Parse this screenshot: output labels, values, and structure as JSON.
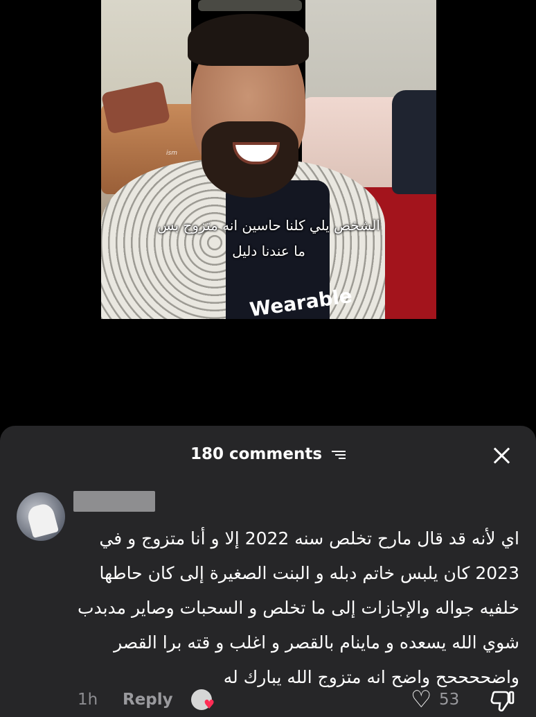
{
  "video": {
    "caption_line1": "الشخص يلي كلنا حاسين انه متزوج بس",
    "caption_line2": "ما عندنا دليل",
    "watermark": "ism",
    "shirt_text": "Wearable"
  },
  "comments_panel": {
    "title": "180 comments",
    "close_icon": "close-icon",
    "filter_icon": "filter-icon"
  },
  "comment": {
    "lines": [
      "اي لأنه قد قال مارح تخلص سنه 2022 إلا و أنا متزوج و في",
      "2023 كان يلبس خاتم دبله و البنت الصغيرة إلى كان حاطها",
      "خلفيه جواله والإجازات إلى ما تخلص و السحبات وصاير مدبدب",
      "شوي الله يسعده و ماينام بالقصر و اغلب و قته برا القصر",
      "واضححححح واضح انه متزوج الله يبارك له"
    ],
    "time": "1h",
    "reply_label": "Reply",
    "like_count": "53"
  },
  "colors": {
    "sheet_bg": "#262628",
    "muted_text": "#8d8d91",
    "creator_heart": "#ff2d55"
  }
}
